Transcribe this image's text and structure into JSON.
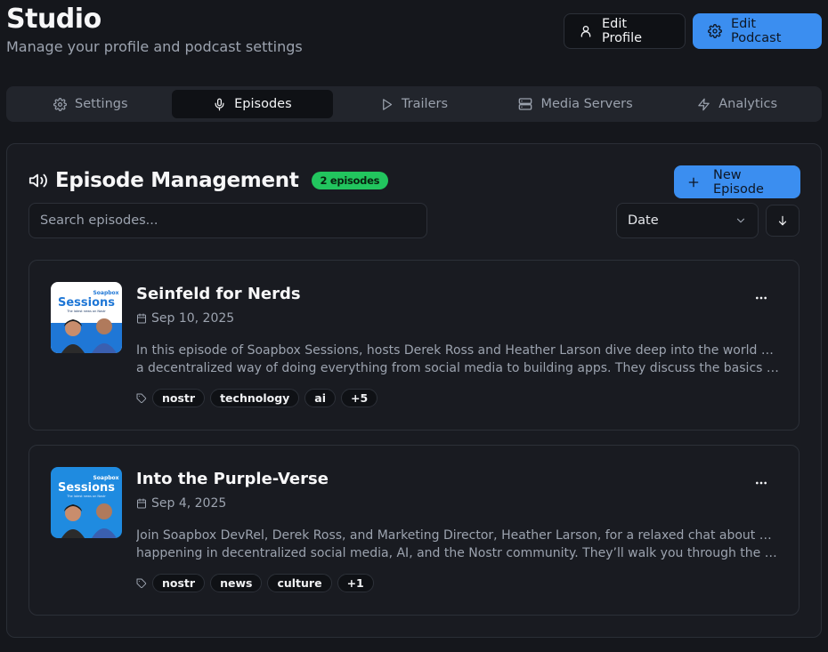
{
  "header": {
    "title": "Studio",
    "subtitle": "Manage your profile and podcast settings",
    "edit_profile_label": "Edit Profile",
    "edit_podcast_label": "Edit Podcast"
  },
  "tabs": [
    {
      "label": "Settings",
      "icon": "gear-icon"
    },
    {
      "label": "Episodes",
      "icon": "microphone-icon",
      "active": true
    },
    {
      "label": "Trailers",
      "icon": "play-icon"
    },
    {
      "label": "Media Servers",
      "icon": "server-icon"
    },
    {
      "label": "Analytics",
      "icon": "lightning-icon"
    }
  ],
  "episodes_panel": {
    "title": "Episode Management",
    "count_badge": "2 episodes",
    "new_button_label": "New Episode",
    "search_placeholder": "Search episodes...",
    "sort_select_value": "Date",
    "sort_direction_icon": "arrow-down-icon"
  },
  "thumbnail": {
    "brand": "Soapbox",
    "title": "Sessions",
    "tagline": "The latest news on Nostr"
  },
  "episodes": [
    {
      "title": "Seinfeld for Nerds",
      "date": "Sep 10, 2025",
      "description_line1": "In this episode of Soapbox Sessions, hosts Derek Ross and Heather Larson dive deep into the world of Nostr,",
      "description_line2": "a decentralized way of doing everything from social media to building apps. They discuss the basics of Nostr, how it works, and why it matters.",
      "tags": [
        "nostr",
        "technology",
        "ai"
      ],
      "more_tags": "+5"
    },
    {
      "title": "Into the Purple-Verse",
      "date": "Sep 4, 2025",
      "description_line1": "Join Soapbox DevRel, Derek Ross, and Marketing Director, Heather Larson, for a relaxed chat about what’s",
      "description_line2": "happening in decentralized social media, AI, and the Nostr community. They’ll walk you through the newest updates.",
      "tags": [
        "nostr",
        "news",
        "culture"
      ],
      "more_tags": "+1"
    }
  ],
  "colors": {
    "background": "#15171c",
    "card": "#191b21",
    "accent_blue": "#3b8ef0",
    "badge_green": "#22c55e",
    "muted_text": "#9ca3af"
  }
}
